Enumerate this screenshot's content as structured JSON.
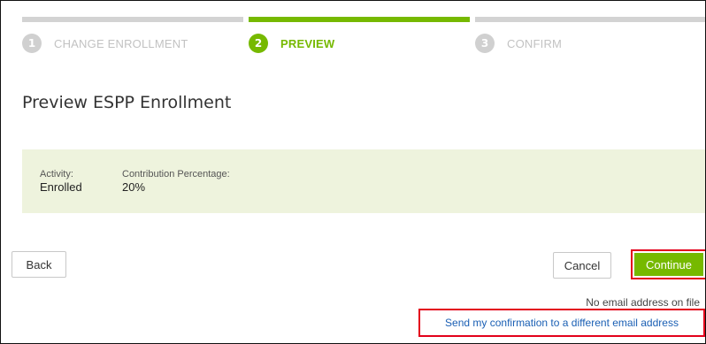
{
  "stepper": {
    "steps": [
      {
        "number": "1",
        "label": "CHANGE ENROLLMENT",
        "state": "inactive"
      },
      {
        "number": "2",
        "label": "PREVIEW",
        "state": "active"
      },
      {
        "number": "3",
        "label": "CONFIRM",
        "state": "inactive"
      }
    ]
  },
  "page": {
    "title": "Preview ESPP Enrollment"
  },
  "summary": {
    "activity_label": "Activity:",
    "activity_value": "Enrolled",
    "contribution_label": "Contribution Percentage:",
    "contribution_value": "20%"
  },
  "actions": {
    "back_label": "Back",
    "cancel_label": "Cancel",
    "continue_label": "Continue"
  },
  "email": {
    "note": "No email address on file",
    "link": "Send my confirmation to a different email address"
  },
  "colors": {
    "accent_green": "#76b900",
    "summary_bg": "#eef3dd",
    "highlight_red": "#e3001b",
    "link_blue": "#1a5fb4"
  }
}
